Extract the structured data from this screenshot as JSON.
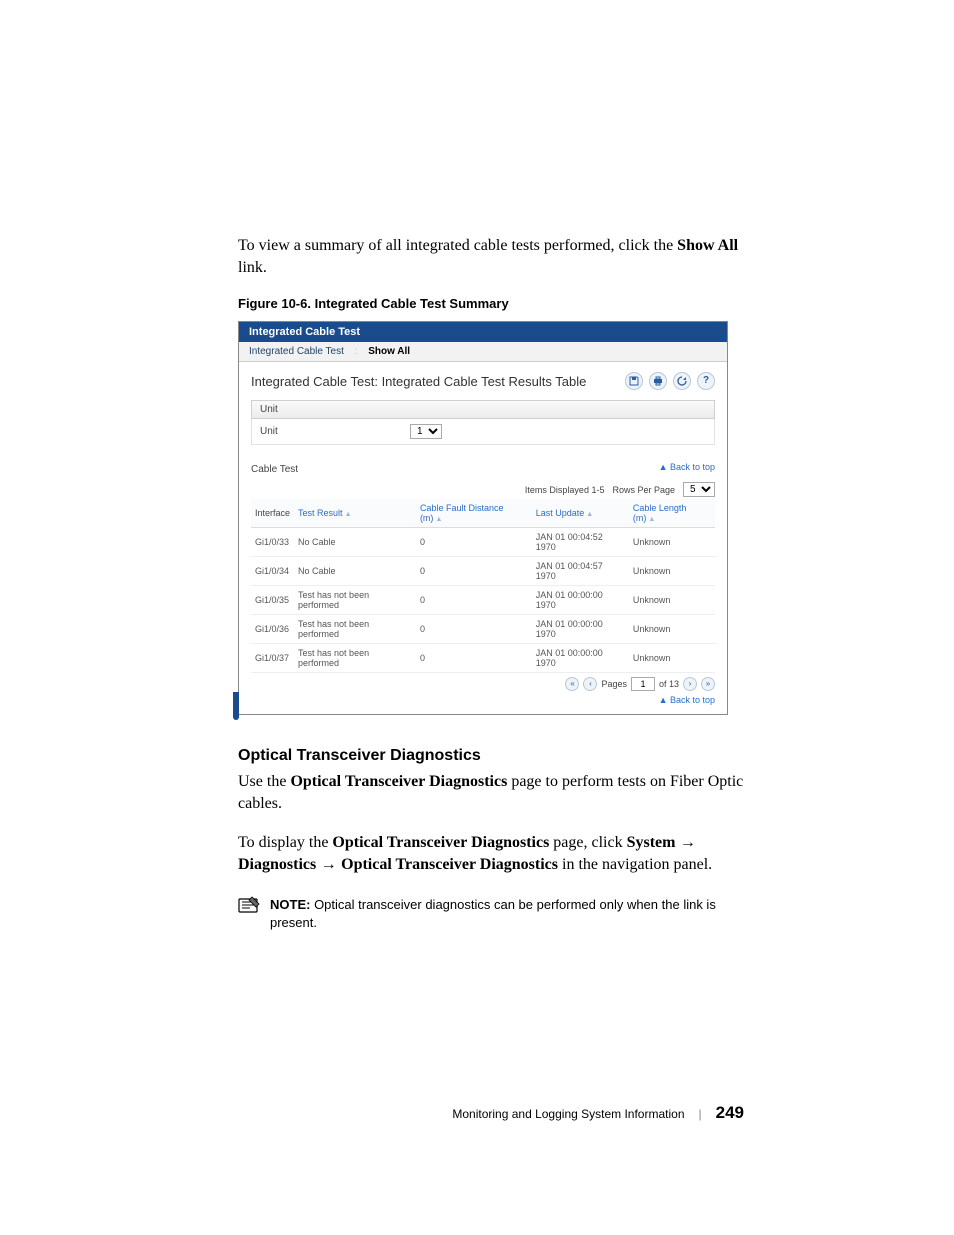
{
  "intro": {
    "pre": "To view a summary of all integrated cable tests performed, click the ",
    "bold": "Show All",
    "post": " link."
  },
  "figure_caption": "Figure 10-6.    Integrated Cable Test Summary",
  "screenshot": {
    "tab_title": "Integrated Cable Test",
    "subtab_left": "Integrated Cable Test",
    "subtab_right": "Show All",
    "panel_title": "Integrated Cable Test: Integrated Cable Test Results Table",
    "unit_section": "Unit",
    "unit_label": "Unit",
    "unit_value": "1",
    "cable_section": "Cable Test",
    "back_to_top": "▲ Back to top",
    "items_displayed": "Items Displayed 1-5",
    "rows_per_page_label": "Rows Per Page",
    "rows_per_page_value": "5",
    "columns": {
      "interface": "Interface",
      "test_result": "Test Result",
      "fault_distance": "Cable Fault Distance (m)",
      "last_update": "Last Update",
      "cable_length": "Cable Length (m)"
    },
    "rows": [
      {
        "iface": "Gi1/0/33",
        "result": "No Cable",
        "dist": "0",
        "update": "JAN 01 00:04:52 1970",
        "len": "Unknown"
      },
      {
        "iface": "Gi1/0/34",
        "result": "No Cable",
        "dist": "0",
        "update": "JAN 01 00:04:57 1970",
        "len": "Unknown"
      },
      {
        "iface": "Gi1/0/35",
        "result": "Test has not been performed",
        "dist": "0",
        "update": "JAN 01 00:00:00 1970",
        "len": "Unknown"
      },
      {
        "iface": "Gi1/0/36",
        "result": "Test has not been performed",
        "dist": "0",
        "update": "JAN 01 00:00:00 1970",
        "len": "Unknown"
      },
      {
        "iface": "Gi1/0/37",
        "result": "Test has not been performed",
        "dist": "0",
        "update": "JAN 01 00:00:00 1970",
        "len": "Unknown"
      }
    ],
    "pager": {
      "pages_label": "Pages",
      "current": "1",
      "of_total": "of 13"
    }
  },
  "section_heading": "Optical Transceiver Diagnostics",
  "para2": {
    "pre": "Use the ",
    "bold": "Optical Transceiver Diagnostics",
    "post": " page to perform tests on Fiber Optic cables."
  },
  "para3": {
    "p1": "To display the ",
    "b1": "Optical Transceiver Diagnostics",
    "p2": " page, click ",
    "b2": "System",
    "arrow": " → ",
    "b3": "Diagnostics",
    "b4": "Optical Transceiver Diagnostics",
    "p3": " in the navigation panel."
  },
  "note": {
    "label": "NOTE:",
    "text": " Optical transceiver diagnostics can be performed only when the link is present."
  },
  "footer": {
    "section": "Monitoring and Logging System Information",
    "page": "249"
  }
}
